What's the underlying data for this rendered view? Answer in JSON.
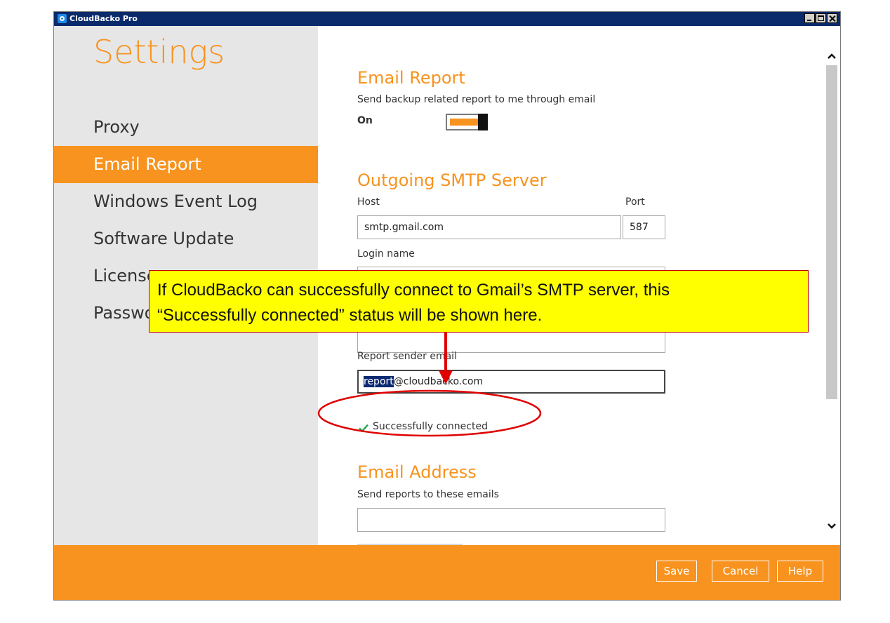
{
  "window": {
    "title": "CloudBacko Pro"
  },
  "sidebar": {
    "title": "Settings",
    "items": [
      {
        "label": "Proxy",
        "active": false
      },
      {
        "label": "Email Report",
        "active": true
      },
      {
        "label": "Windows Event Log",
        "active": false
      },
      {
        "label": "Software Update",
        "active": false
      },
      {
        "label": "License",
        "active": false
      },
      {
        "label": "Password",
        "active": false
      }
    ]
  },
  "email_report": {
    "heading": "Email Report",
    "description": "Send backup related report to me through email",
    "toggle_state": "On"
  },
  "smtp": {
    "heading": "Outgoing SMTP Server",
    "host_label": "Host",
    "host_value": "smtp.gmail.com",
    "port_label": "Port",
    "port_value": "587",
    "login_label": "Login name",
    "sender_label": "Report sender email",
    "sender_selected": "report",
    "sender_rest": "@cloudbacko.com",
    "status": "Successfully connected"
  },
  "email_address": {
    "heading": "Email Address",
    "send_label": "Send reports to these emails"
  },
  "footer": {
    "save": "Save",
    "cancel": "Cancel",
    "help": "Help"
  },
  "callout": {
    "line1": "If CloudBacko can successfully connect to Gmail’s SMTP server, this",
    "line2": "“Successfully connected” status will be shown here."
  },
  "colors": {
    "accent": "#f7931e",
    "sidebar_bg": "#e6e6e6",
    "titlebar": "#0a2a6c",
    "callout_bg": "#ffff00",
    "annotation": "#e00000",
    "check": "#1aa34a"
  }
}
